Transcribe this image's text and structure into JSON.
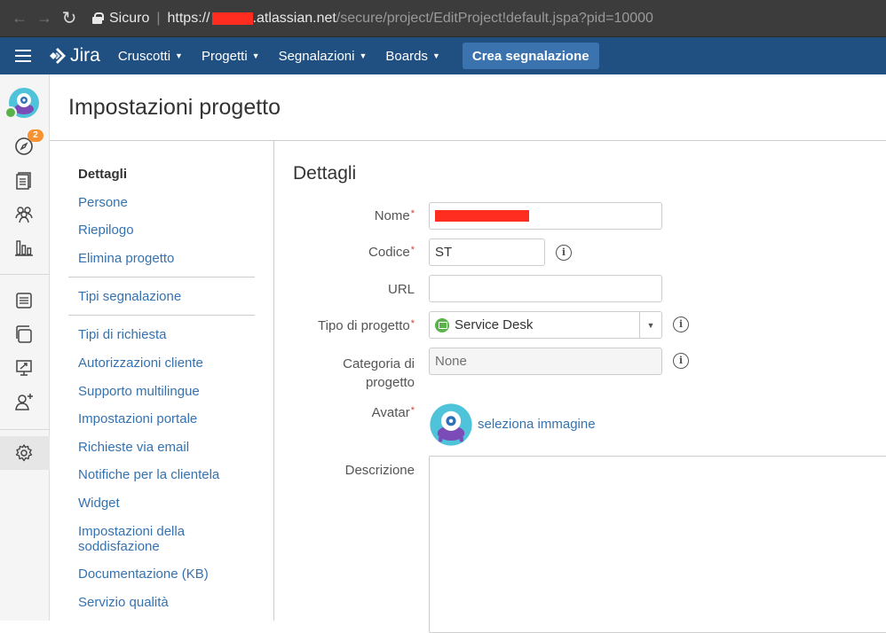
{
  "browser": {
    "secure_label": "Sicuro",
    "url_scheme": "https://",
    "url_host": ".atlassian.net",
    "url_path": "/secure/project/EditProject!default.jspa?pid=10000"
  },
  "header": {
    "logo_text": "Jira",
    "menus": [
      {
        "label": "Cruscotti"
      },
      {
        "label": "Progetti"
      },
      {
        "label": "Segnalazioni"
      },
      {
        "label": "Boards"
      }
    ],
    "create_label": "Crea segnalazione"
  },
  "rail": {
    "notification_count": "2",
    "icons": [
      "project-avatar-icon",
      "compass-icon",
      "queues-icon",
      "customers-icon",
      "reports-icon",
      "knowledge-base-icon",
      "raise-request-icon",
      "channels-icon",
      "invite-team-icon",
      "gear-icon"
    ]
  },
  "page": {
    "title": "Impostazioni progetto"
  },
  "sidebar": {
    "group1": [
      {
        "label": "Dettagli",
        "active": true
      },
      {
        "label": "Persone"
      },
      {
        "label": "Riepilogo"
      },
      {
        "label": "Elimina progetto"
      }
    ],
    "group2": [
      {
        "label": "Tipi segnalazione"
      }
    ],
    "group3": [
      {
        "label": "Tipi di richiesta"
      },
      {
        "label": "Autorizzazioni cliente"
      },
      {
        "label": "Supporto multilingue"
      },
      {
        "label": "Impostazioni portale"
      },
      {
        "label": "Richieste via email"
      },
      {
        "label": "Notifiche per la clientela"
      },
      {
        "label": "Widget"
      },
      {
        "label": "Impostazioni della soddisfazione"
      },
      {
        "label": "Documentazione (KB)"
      },
      {
        "label": "Servizio qualità"
      }
    ]
  },
  "form": {
    "section_title": "Dettagli",
    "required_marker": "*",
    "name_label": "Nome",
    "code_label": "Codice",
    "code_value": "ST",
    "url_label": "URL",
    "url_value": "",
    "type_label": "Tipo di progetto",
    "type_value": "Service Desk",
    "category_label_1": "Categoria di",
    "category_label_2": "progetto",
    "category_value": "None",
    "avatar_label": "Avatar",
    "avatar_link": "seleziona immagine",
    "description_label": "Descrizione",
    "info_glyph": "i"
  },
  "colors": {
    "header_bg": "#205081",
    "create_button": "#3b73af",
    "link": "#3572b0",
    "required": "#d04437",
    "badge": "#f79232",
    "service_desk_green": "#59b24a"
  }
}
